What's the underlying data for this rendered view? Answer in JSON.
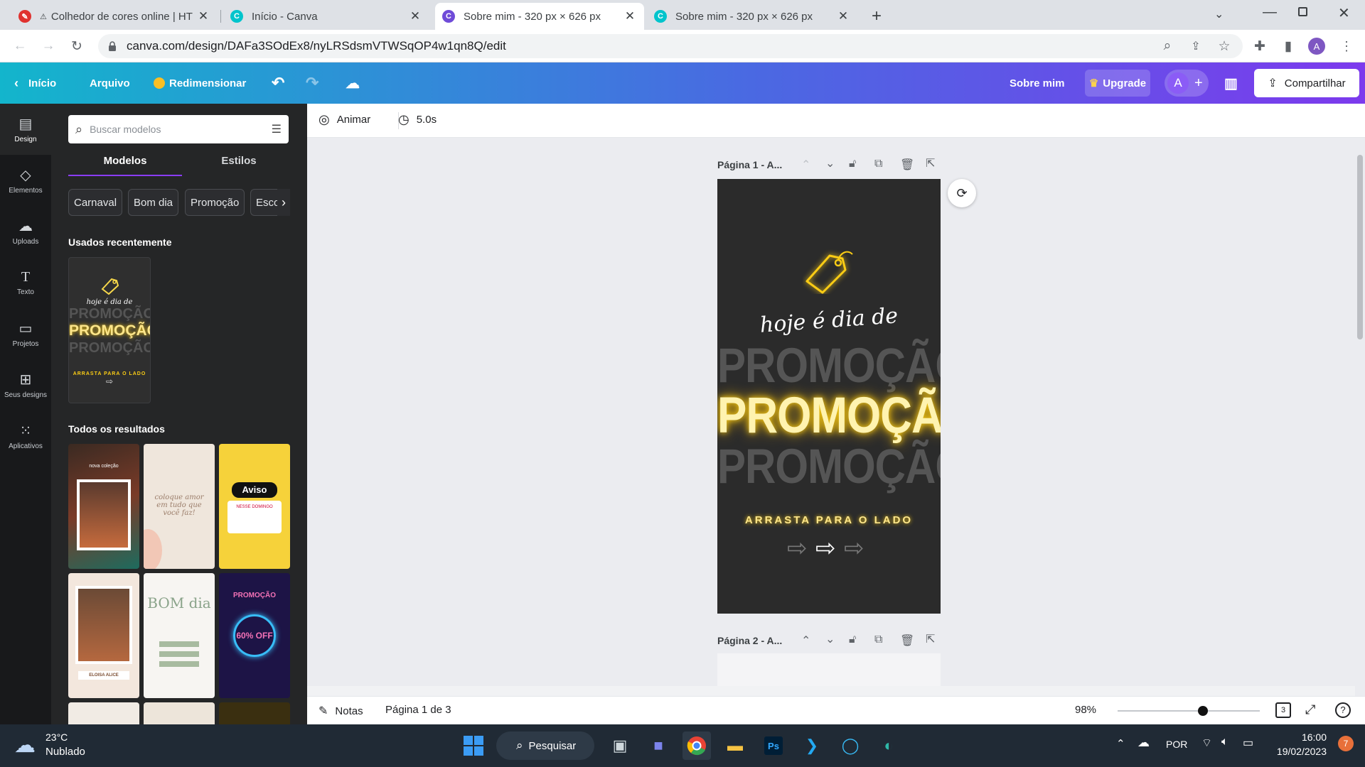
{
  "browser": {
    "tabs": [
      {
        "title": "Colhedor de cores online | HT",
        "active": false
      },
      {
        "title": "Início - Canva",
        "active": false
      },
      {
        "title": "Sobre mim - 320 px × 626 px",
        "active": true
      },
      {
        "title": "Sobre mim - 320 px × 626 px",
        "active": false
      }
    ],
    "url": "canva.com/design/DAFa3SOdEx8/nyLRSdsmVTWSqOP4w1qn8Q/edit",
    "profile_initial": "A"
  },
  "header": {
    "back_label": "Início",
    "file_label": "Arquivo",
    "resize_label": "Redimensionar",
    "design_title": "Sobre mim",
    "upgrade_label": "Upgrade",
    "avatar_initial": "A",
    "share_label": "Compartilhar"
  },
  "rail": {
    "items": [
      {
        "label": "Design",
        "icon": "layout-icon"
      },
      {
        "label": "Elementos",
        "icon": "shapes-icon"
      },
      {
        "label": "Uploads",
        "icon": "upload-cloud-icon"
      },
      {
        "label": "Texto",
        "icon": "text-icon"
      },
      {
        "label": "Projetos",
        "icon": "folder-icon"
      },
      {
        "label": "Seus designs",
        "icon": "grid-icon"
      },
      {
        "label": "Aplicativos",
        "icon": "apps-icon"
      }
    ]
  },
  "panel": {
    "search_placeholder": "Buscar modelos",
    "tabs": [
      "Modelos",
      "Estilos"
    ],
    "chips": [
      "Carnaval",
      "Bom dia",
      "Promoção",
      "Escola"
    ],
    "recent_heading": "Usados recentemente",
    "all_heading": "Todos os resultados",
    "recent_thumb": {
      "script": "hoje é dia de",
      "word": "PROMOÇÃO",
      "footer": "ARRASTA PARA O LADO"
    },
    "results": [
      {
        "text": "nova coleção"
      },
      {
        "text": "coloque amor em tudo que você faz!"
      },
      {
        "text": "Aviso",
        "sub": "NESSE DOMINGO"
      },
      {
        "text": "ELOISA ALICE"
      },
      {
        "text": "BOM dia"
      },
      {
        "text": "PROMOÇÃO",
        "sub": "60% OFF"
      }
    ]
  },
  "editor": {
    "animate_label": "Animar",
    "duration_label": "5.0s",
    "pages": [
      {
        "label": "Página 1 - A..."
      },
      {
        "label": "Página 2 - A..."
      }
    ],
    "design": {
      "script_text": "hoje é dia de",
      "main_word": "PROMOÇÃO",
      "cta": "ARRASTA PARA O LADO"
    }
  },
  "bottom": {
    "notes_label": "Notas",
    "page_indicator": "Página 1 de 3",
    "zoom": "98%",
    "zoom_fraction": 0.6,
    "page_count": "3"
  },
  "taskbar": {
    "temp": "23°C",
    "weather": "Nublado",
    "search_label": "Pesquisar",
    "lang": "POR",
    "time": "16:00",
    "date": "19/02/2023",
    "notification_count": "7"
  },
  "colors": {
    "accent": "#8b3dff",
    "header_start": "#13b5cc",
    "header_end": "#7c3aed",
    "neon_yellow": "#ffe066",
    "panel_bg": "#252627"
  }
}
